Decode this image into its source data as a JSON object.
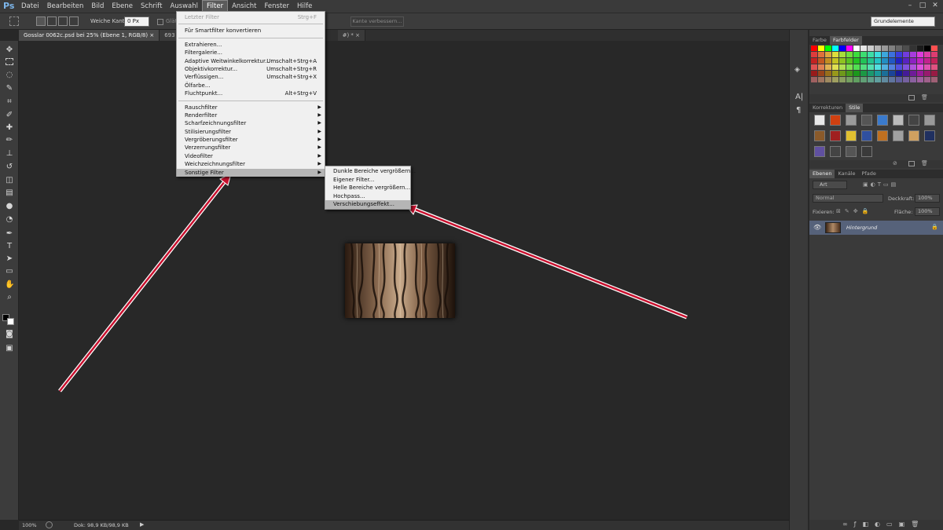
{
  "app": {
    "logo": "Ps"
  },
  "menubar": {
    "items": [
      "Datei",
      "Bearbeiten",
      "Bild",
      "Ebene",
      "Schrift",
      "Auswahl",
      "Filter",
      "Ansicht",
      "Fenster",
      "Hilfe"
    ],
    "active": "Filter"
  },
  "options": {
    "feather_label": "Weiche Kante:",
    "feather_value": "0 Px",
    "antialias_label": "Glätt.",
    "refine_button": "Kante verbessern...",
    "workspace": "Grundelemente"
  },
  "tabs": [
    {
      "label": "Gosslar 0062c.psd bei 25% (Ebene 1, RGB/8)"
    },
    {
      "label": "693"
    },
    {
      "label": "#) *"
    }
  ],
  "filter_menu": {
    "last_filter": "Letzter Filter",
    "last_filter_shortcut": "Strg+F",
    "smart": "Für Smartfilter konvertieren",
    "group1": [
      {
        "label": "Extrahieren...",
        "shortcut": ""
      },
      {
        "label": "Filtergalerie...",
        "shortcut": ""
      },
      {
        "label": "Adaptive Weitwinkelkorrektur...",
        "shortcut": "Umschalt+Strg+A"
      },
      {
        "label": "Objektivkorrektur...",
        "shortcut": "Umschalt+Strg+R"
      },
      {
        "label": "Verflüssigen...",
        "shortcut": "Umschalt+Strg+X"
      },
      {
        "label": "Ölfarbe...",
        "shortcut": ""
      },
      {
        "label": "Fluchtpunkt...",
        "shortcut": "Alt+Strg+V"
      }
    ],
    "group2": [
      "Rauschfilter",
      "Renderfilter",
      "Scharfzeichnungsfilter",
      "Stilisierungsfilter",
      "Vergröberungsfilter",
      "Verzerrungsfilter",
      "Videofilter",
      "Weichzeichnungsfilter",
      "Sonstige Filter"
    ],
    "highlighted": "Sonstige Filter"
  },
  "submenu": {
    "items": [
      "Dunkle Bereiche vergrößern...",
      "Eigener Filter...",
      "Helle Bereiche vergrößern...",
      "Hochpass...",
      "Verschiebungseffekt..."
    ],
    "highlighted": "Verschiebungseffekt..."
  },
  "status": {
    "zoom": "100%",
    "doc": "Dok: 98,9 KB/98,9 KB"
  },
  "panels": {
    "swatch_tabs": [
      "Farbe",
      "Farbfelder"
    ],
    "adjust_tabs": [
      "Korrekturen",
      "Stile"
    ],
    "layer_tabs": [
      "Ebenen",
      "Kanäle",
      "Pfade"
    ],
    "kind": "Art",
    "blend_mode": "Normal",
    "opacity_label": "Deckkraft:",
    "opacity_value": "100%",
    "lock_label": "Fixieren:",
    "fill_label": "Fläche:",
    "fill_value": "100%",
    "layer_name": "Hintergrund"
  },
  "colors": {
    "accent": "#c8102e",
    "highlight_row": "#56627a"
  }
}
